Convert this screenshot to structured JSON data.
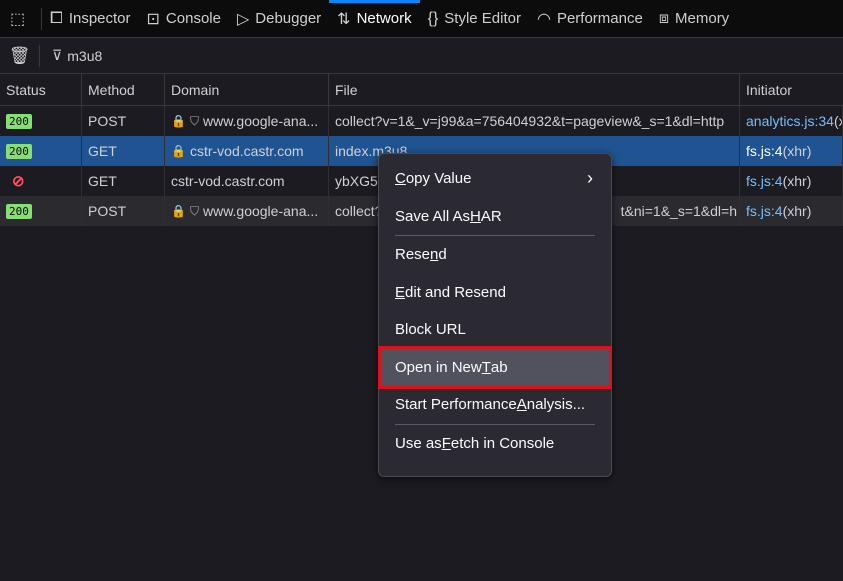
{
  "tabs": [
    {
      "label": "",
      "icon": "element-picker-icon"
    },
    {
      "label": "Inspector",
      "icon": "inspector-icon",
      "glyph": "⧠"
    },
    {
      "label": "Console",
      "icon": "console-icon",
      "glyph": "⊡"
    },
    {
      "label": "Debugger",
      "icon": "debugger-icon",
      "glyph": "▷"
    },
    {
      "label": "Network",
      "icon": "network-icon",
      "glyph": "⇅",
      "active": true
    },
    {
      "label": "Style Editor",
      "icon": "style-editor-icon",
      "glyph": "{}"
    },
    {
      "label": "Performance",
      "icon": "performance-icon",
      "glyph": "◠"
    },
    {
      "label": "Memory",
      "icon": "memory-icon",
      "glyph": "⧈"
    }
  ],
  "toolbar": {
    "filter_value": "m3u8",
    "trash_icon": "trash-icon",
    "filter_icon": "filter-icon"
  },
  "columns": [
    "Status",
    "Method",
    "Domain",
    "File",
    "Initiator"
  ],
  "rows": [
    {
      "status": "200",
      "method": "POST",
      "domain": "www.google-ana...",
      "file": "collect?v=1&_v=j99&a=756404932&t=pageview&_s=1&dl=http",
      "initiator": "analytics.js:34",
      "initiator_suffix": " (x",
      "lock": true,
      "tracker": true
    },
    {
      "status": "200",
      "method": "GET",
      "domain": "cstr-vod.castr.com",
      "file": "index.m3u8",
      "initiator": "fs.js:4",
      "initiator_suffix": " (xhr)",
      "lock": true,
      "selected": true
    },
    {
      "status": "blocked",
      "method": "GET",
      "domain": "cstr-vod.castr.com",
      "file": "ybXG5",
      "initiator": "fs.js:4",
      "initiator_suffix": " (xhr)",
      "error": true
    },
    {
      "status": "200",
      "method": "POST",
      "domain": "www.google-ana...",
      "file": "collect?",
      "file_tail": "t&ni=1&_s=1&dl=h",
      "initiator": "fs.js:4",
      "initiator_suffix": " (xhr)",
      "lock": true,
      "tracker": true,
      "hover": true
    }
  ],
  "menu": [
    {
      "pre": "",
      "key": "C",
      "post": "opy Value",
      "submenu": true
    },
    {
      "pre": "Save All As ",
      "key": "H",
      "post": "AR"
    },
    {
      "sep": true
    },
    {
      "pre": "Rese",
      "key": "n",
      "post": "d"
    },
    {
      "pre": "",
      "key": "E",
      "post": "dit and Resend"
    },
    {
      "pre": "Block URL",
      "key": "",
      "post": ""
    },
    {
      "pre": "Open in New ",
      "key": "T",
      "post": "ab",
      "highlighted": true
    },
    {
      "pre": "Start Performance ",
      "key": "A",
      "post": "nalysis..."
    },
    {
      "sep": true
    },
    {
      "pre": "Use as ",
      "key": "F",
      "post": "etch in Console"
    }
  ],
  "colors": {
    "accent": "#0a84ff",
    "selected_row": "#1f5392",
    "status_ok": "#86de74",
    "highlight_box": "#e0101a"
  }
}
